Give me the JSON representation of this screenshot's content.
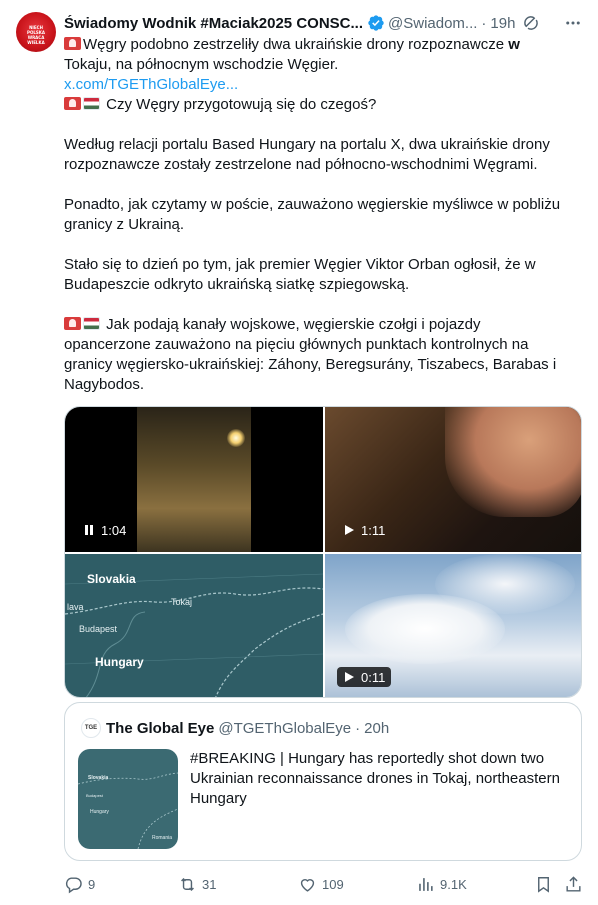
{
  "author": {
    "name": "Świadomy Wodnik #Maciak2025 CONSC...",
    "handle": "@Swiadom...",
    "separator": "·",
    "time": "19h",
    "avatar_cap_text": "NIECH POLSKA WRACA WIELKA",
    "verified_color": "#1d9bf0"
  },
  "tweet": {
    "lines": [
      {
        "prefix": "Węgry podobno zestrzeliły dwa ukraińskie drony rozpoznawcze ",
        "bold": "w"
      },
      {
        "text": "Tokaju, na północnym wschodzie Węgier."
      },
      {
        "link": "x.com/TGEThGlobalEye..."
      },
      {
        "text": " Czy Węgry przygotowują się do czegoś?"
      },
      {
        "text": "Według relacji portalu Based Hungary na portalu X, dwa ukraińskie drony"
      },
      {
        "text": "rozpoznawcze zostały zestrzelone nad północno-wschodnimi Węgrami."
      },
      {
        "text": "Ponadto, jak czytamy w poście, zauważono węgierskie myśliwce w pobliżu"
      },
      {
        "text": "granicy z Ukrainą."
      },
      {
        "text": "Stało się to dzień po tym, jak premier Węgier Viktor Orban ogłosił, że w"
      },
      {
        "text": "Budapeszcie odkryto ukraińską siatkę szpiegowską."
      },
      {
        "text": " Jak podają kanały wojskowe, węgierskie czołgi i pojazdy"
      },
      {
        "text": "opancerzone zauważono na pięciu głównych punktach kontrolnych na"
      },
      {
        "text": "granicy węgiersko-ukraińskiej: Záhony, Beregsurány, Tiszabecs, Barabas i"
      },
      {
        "text": "Nagybodos."
      }
    ]
  },
  "media": {
    "video1_duration": "1:04",
    "video2_duration": "1:11",
    "video4_duration": "0:11",
    "map_labels": {
      "slovakia": "Slovakia",
      "tokaj": "Tokaj",
      "lava": "lava",
      "budapest": "Budapest",
      "hungary": "Hungary"
    }
  },
  "quote": {
    "logo_text": "TGE",
    "name": "The Global Eye",
    "handle": "@TGEThGlobalEye",
    "separator": "·",
    "time": "20h",
    "text": "#BREAKING | Hungary has reportedly shot down two Ukrainian reconnaissance drones in Tokaj, northeastern Hungary",
    "thumb_labels": {
      "slovakia": "Slovakia",
      "budapest": "Budapest",
      "hungary": "Hungary",
      "romania": "Romania"
    }
  },
  "actions": {
    "replies": "9",
    "retweets": "31",
    "likes": "109",
    "views": "9.1K"
  },
  "colors": {
    "text": "#0f1419",
    "secondary": "#536471",
    "link": "#1d9bf0",
    "border": "#cfd9de"
  }
}
